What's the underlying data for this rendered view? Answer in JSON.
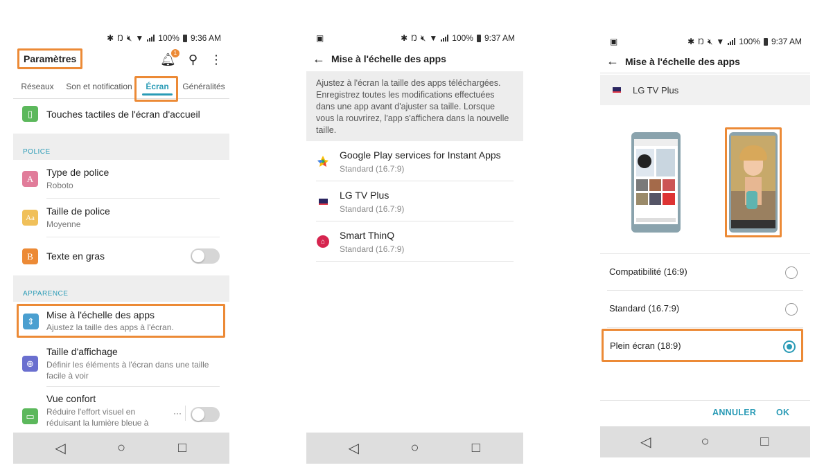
{
  "colors": {
    "accent": "#2a9bb6",
    "highlight": "#ec8a36",
    "nav": "#dedede"
  },
  "phone1": {
    "status": {
      "battery": "100%",
      "time": "9:36 AM"
    },
    "title": "Paramètres",
    "notification_badge": "1",
    "actions": [
      "bell-icon",
      "search-icon",
      "more-vert-icon"
    ],
    "tabs": [
      "Réseaux",
      "Son et notification",
      "Écran",
      "Généralités"
    ],
    "active_tab": "Écran",
    "rows": {
      "touches": {
        "label": "Touches tactiles de l'écran d'accueil",
        "icon": "phone-icon"
      },
      "police_header": "POLICE",
      "type_police": {
        "label": "Type de police",
        "value": "Roboto",
        "icon_text": "A"
      },
      "taille_police": {
        "label": "Taille de police",
        "value": "Moyenne",
        "icon_text": "Aa"
      },
      "texte_gras": {
        "label": "Texte en gras",
        "icon_text": "B",
        "toggle": "off"
      },
      "apparence_header": "APPARENCE",
      "mise_echelle": {
        "label": "Mise à l'échelle des apps",
        "value": "Ajustez la taille des apps à l'écran."
      },
      "taille_affichage": {
        "label": "Taille d'affichage",
        "value1": "Définir les éléments à l'écran dans une taille",
        "value2": "facile à voir"
      },
      "vue_confort": {
        "label": "Vue confort",
        "value1": "Réduire l'effort visuel en",
        "value2": "réduisant la lumière bleue à",
        "more": "···",
        "toggle": "off"
      }
    }
  },
  "phone2": {
    "status": {
      "battery": "100%",
      "time": "9:37 AM"
    },
    "title": "Mise à l'échelle des apps",
    "description": "Ajustez à l'écran la taille des apps téléchargées. Enregistrez toutes les modifications effectuées dans une app avant d'ajuster sa taille. Lorsque vous la rouvrirez, l'app s'affichera dans la nouvelle taille.",
    "apps": [
      {
        "name": "Google Play services for Instant Apps",
        "setting": "Standard (16.7:9)"
      },
      {
        "name": "LG TV Plus",
        "setting": "Standard (16.7:9)"
      },
      {
        "name": "Smart ThinQ",
        "setting": "Standard (16.7:9)"
      }
    ]
  },
  "phone3": {
    "status": {
      "battery": "100%",
      "time": "9:37 AM"
    },
    "title": "Mise à l'échelle des apps",
    "app_name": "LG TV Plus",
    "options": [
      {
        "label": "Compatibilité (16:9)",
        "selected": false
      },
      {
        "label": "Standard (16.7:9)",
        "selected": false
      },
      {
        "label": "Plein écran (18:9)",
        "selected": true
      }
    ],
    "cancel": "ANNULER",
    "ok": "OK"
  }
}
